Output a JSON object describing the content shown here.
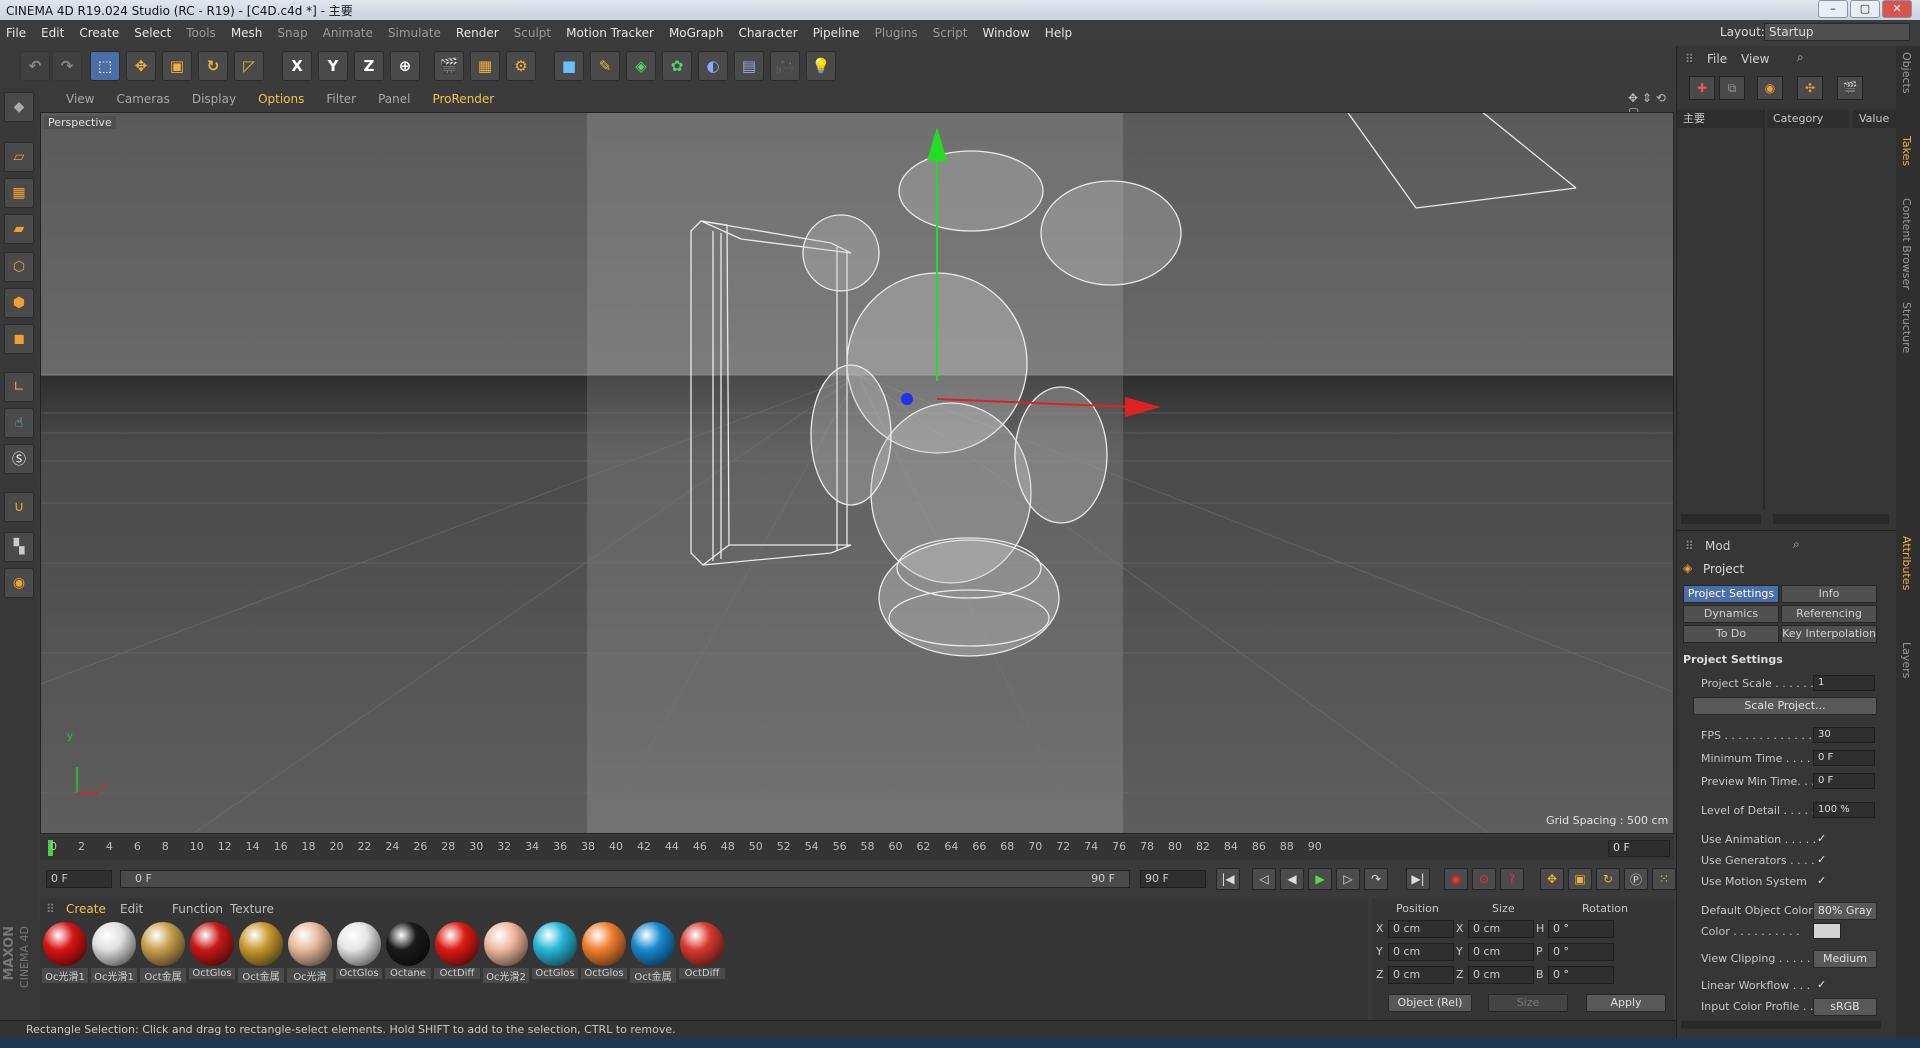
{
  "window": {
    "title": "CINEMA 4D R19.024 Studio (RC - R19) - [C4D.c4d *] - 主要",
    "min": "–",
    "max": "▢",
    "close": "✕"
  },
  "menu": [
    {
      "label": "File",
      "dim": false
    },
    {
      "label": "Edit",
      "dim": false
    },
    {
      "label": "Create",
      "dim": false
    },
    {
      "label": "Select",
      "dim": false
    },
    {
      "label": "Tools",
      "dim": true
    },
    {
      "label": "Mesh",
      "dim": false
    },
    {
      "label": "Snap",
      "dim": true
    },
    {
      "label": "Animate",
      "dim": true
    },
    {
      "label": "Simulate",
      "dim": true
    },
    {
      "label": "Render",
      "dim": false
    },
    {
      "label": "Sculpt",
      "dim": true
    },
    {
      "label": "Motion Tracker",
      "dim": false
    },
    {
      "label": "MoGraph",
      "dim": false
    },
    {
      "label": "Character",
      "dim": false
    },
    {
      "label": "Pipeline",
      "dim": false
    },
    {
      "label": "Plugins",
      "dim": true
    },
    {
      "label": "Script",
      "dim": true
    },
    {
      "label": "Window",
      "dim": false
    },
    {
      "label": "Help",
      "dim": false
    }
  ],
  "layout": {
    "label": "Layout:",
    "value": "Startup"
  },
  "toolbar": {
    "x": "X",
    "y": "Y",
    "z": "Z"
  },
  "viewport": {
    "menu": [
      "View",
      "Cameras",
      "Display",
      "Options",
      "Filter",
      "Panel",
      "ProRender"
    ],
    "highlight": [
      "Options",
      "ProRender"
    ],
    "camera": "Perspective",
    "grid_spacing": "Grid Spacing : 500 cm",
    "axis_y": "y",
    "axis_x": "x"
  },
  "timeline": {
    "ticks": [
      "0",
      "2",
      "4",
      "6",
      "8",
      "10",
      "12",
      "14",
      "16",
      "18",
      "20",
      "22",
      "24",
      "26",
      "28",
      "30",
      "32",
      "34",
      "36",
      "38",
      "40",
      "42",
      "44",
      "46",
      "48",
      "50",
      "52",
      "54",
      "56",
      "58",
      "60",
      "62",
      "64",
      "66",
      "68",
      "70",
      "72",
      "74",
      "76",
      "78",
      "80",
      "82",
      "84",
      "86",
      "88",
      "90"
    ],
    "current_frame": "0 F",
    "start": "0 F",
    "slider_start": "0 F",
    "slider_end": "90 F",
    "end": "90 F"
  },
  "materials": {
    "menu": [
      "Create",
      "Edit",
      "Function",
      "Texture"
    ],
    "items": [
      {
        "label": "Oc光滑1",
        "color": "#d81414"
      },
      {
        "label": "Oc光滑1",
        "color": "#e0e0e0"
      },
      {
        "label": "Oct金属",
        "color": "#c8a050"
      },
      {
        "label": "OctGlos",
        "color": "#c81818"
      },
      {
        "label": "Oct金属",
        "color": "#c89a30"
      },
      {
        "label": "Oc光滑",
        "color": "#e8bca0"
      },
      {
        "label": "OctGlos",
        "color": "#e6e6e6"
      },
      {
        "label": "Octane",
        "color": "#1a1a1a"
      },
      {
        "label": "OctDiff",
        "color": "#dd1a14"
      },
      {
        "label": "Oc光滑2",
        "color": "#f0b8a0"
      },
      {
        "label": "OctGlos",
        "color": "#28b8d8"
      },
      {
        "label": "OctGlos",
        "color": "#f08030"
      },
      {
        "label": "Oct金属",
        "color": "#1a8ad0"
      },
      {
        "label": "OctDiff",
        "color": "#d83a30"
      }
    ]
  },
  "coords": {
    "headers": [
      "Position",
      "Size",
      "Rotation"
    ],
    "rows": [
      {
        "a": "X",
        "pos": "0 cm",
        "b": "X",
        "size": "0 cm",
        "c": "H",
        "rot": "0 °"
      },
      {
        "a": "Y",
        "pos": "0 cm",
        "b": "Y",
        "size": "0 cm",
        "c": "P",
        "rot": "0 °"
      },
      {
        "a": "Z",
        "pos": "0 cm",
        "b": "Z",
        "size": "0 cm",
        "c": "B",
        "rot": "0 °"
      }
    ],
    "mode": "Object (Rel)",
    "size_mode": "Size",
    "apply": "Apply"
  },
  "status": "Rectangle Selection: Click and drag to rectangle-select elements. Hold SHIFT to add to the selection, CTRL to remove.",
  "objects": {
    "menu": [
      "File",
      "View"
    ],
    "take": "主要",
    "col_category": "Category",
    "col_value": "Value"
  },
  "attributes": {
    "mode": "Mod",
    "title": "Project",
    "tabs": [
      "Project Settings",
      "Info",
      "Dynamics",
      "Referencing",
      "To Do",
      "Key Interpolation"
    ],
    "section": "Project Settings",
    "props": {
      "project_scale": "Project Scale . . . . . .",
      "project_scale_val": "1",
      "scale_project": "Scale Project...",
      "fps": "FPS . . . . . . . . . . . . . .",
      "fps_val": "30",
      "min_time": "Minimum Time . . . . .",
      "min_time_val": "0 F",
      "preview_min": "Preview Min Time. . .",
      "preview_min_val": "0 F",
      "lod": "Level of Detail . . . . .",
      "lod_val": "100 %",
      "use_anim": "Use Animation . . . . .",
      "use_gen": "Use Generators . . . .",
      "use_motion": "Use Motion System",
      "def_color": "Default Object Color",
      "def_color_val": "80% Gray",
      "color": "Color . . . . . . . . . .",
      "view_clip": "View Clipping . . . . . .",
      "view_clip_val": "Medium",
      "linear": "Linear Workflow . . .",
      "input_profile": "Input Color Profile . .",
      "input_profile_val": "sRGB",
      "check": "✓"
    }
  },
  "right_tabs": [
    "Objects",
    "Takes",
    "Content Browser",
    "Structure",
    "Attributes",
    "Layers"
  ],
  "logo": {
    "brand": "MAXON",
    "product": "CINEMA 4D"
  }
}
